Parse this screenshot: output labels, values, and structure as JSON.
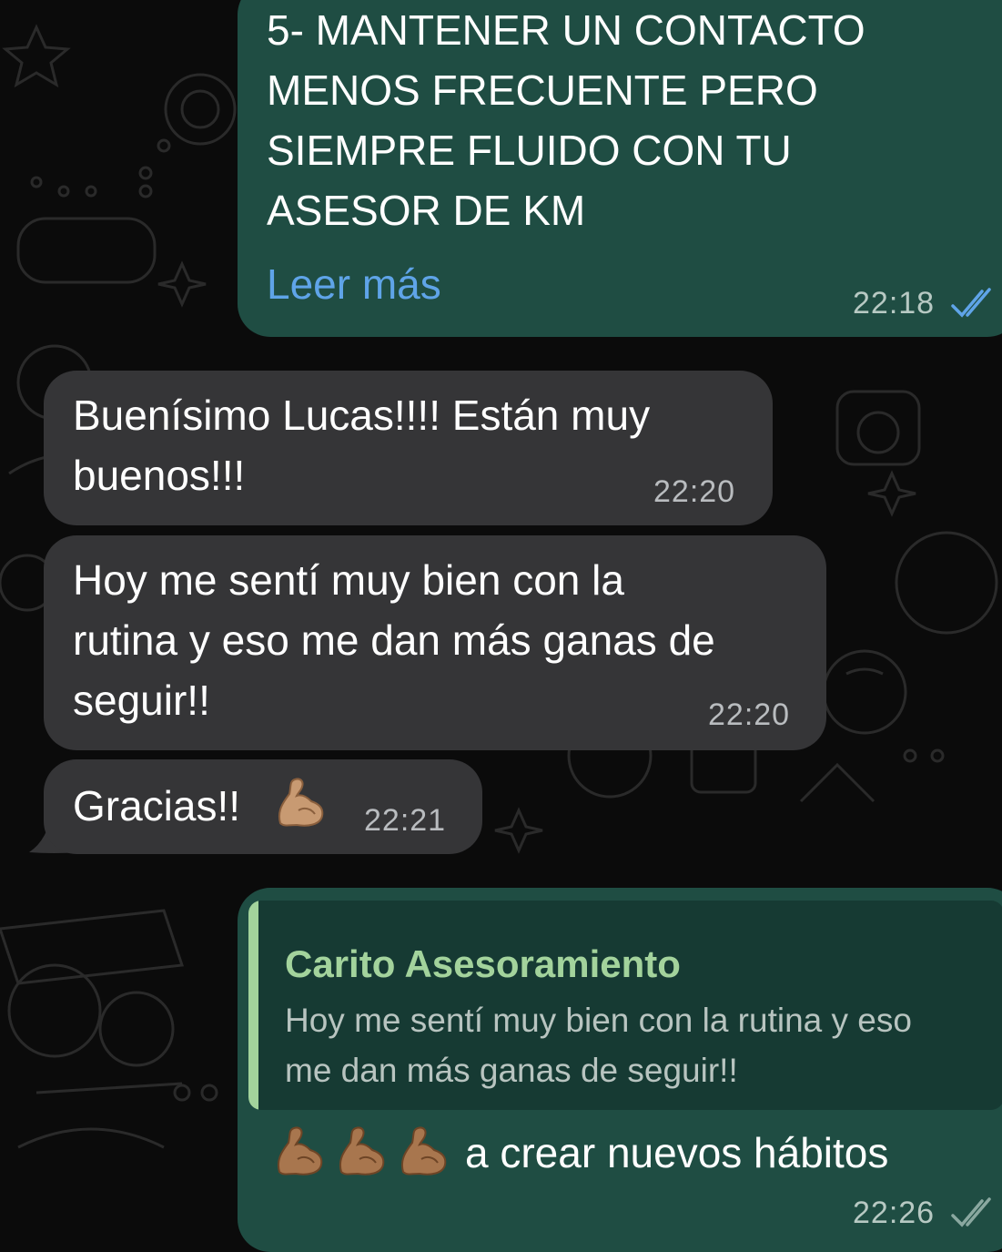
{
  "messages": [
    {
      "direction": "outgoing",
      "text": "5-  MANTENER UN CONTACTO\nMENOS FRECUENTE PERO\nSIEMPRE FLUIDO CON TU\nASESOR DE KM",
      "read_more": "Leer más",
      "time": "22:18",
      "status": "read"
    },
    {
      "direction": "incoming",
      "text": "Buenísimo Lucas!!!! Están muy\nbuenos!!!",
      "time": "22:20"
    },
    {
      "direction": "incoming",
      "text": "Hoy me sentí muy bien con la\nrutina y eso me dan más ganas de\nseguir!!",
      "time": "22:20"
    },
    {
      "direction": "incoming",
      "text": "Gracias!!",
      "emoji": "flexed-biceps",
      "time": "22:21"
    },
    {
      "direction": "outgoing",
      "quote": {
        "author": "Carito Asesoramiento",
        "text": "Hoy me sentí muy bien con la rutina y eso\nme dan más ganas de seguir!!"
      },
      "emoji_count": 3,
      "emoji": "flexed-biceps",
      "text": "a crear nuevos hábitos",
      "time": "22:26",
      "status": "read"
    }
  ],
  "colors": {
    "background": "#0b0b0b",
    "outgoing_bubble": "#1f4d43",
    "incoming_bubble": "#353537",
    "read_ticks": "#5fa4e8",
    "quote_accent": "#a3d39c",
    "link": "#5fa4e8"
  }
}
